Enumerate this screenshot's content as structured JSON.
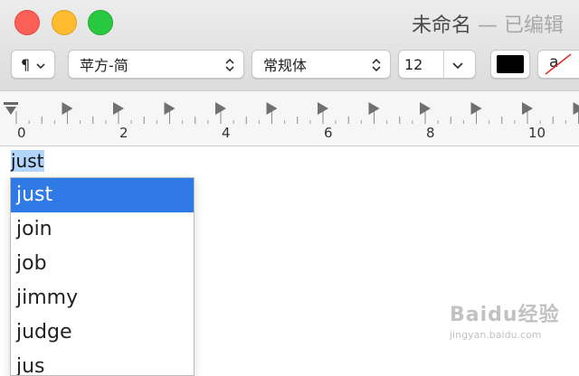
{
  "window": {
    "title": "未命名",
    "title_separator": "—",
    "status": "已编辑"
  },
  "toolbar": {
    "paragraph_style_icon": "¶",
    "font_family": "苹方-简",
    "font_style": "常规体",
    "font_size": "12",
    "text_color": "#000000",
    "highlight_glyph": "a"
  },
  "ruler": {
    "labels": [
      "0",
      "2",
      "4",
      "6",
      "8",
      "10"
    ]
  },
  "document": {
    "typed_text": "just"
  },
  "autocomplete": {
    "suggestions": [
      "just",
      "join",
      "job",
      "jimmy",
      "judge",
      "jus"
    ],
    "selected_index": 0
  },
  "watermark": {
    "brand": "Baidu经验",
    "site": "jingyan.baidu.com"
  },
  "colors": {
    "selection_blue": "#2f7ae5",
    "text_highlight": "#b3d5fb",
    "close": "#fe5f57",
    "minimize": "#febc2e",
    "zoom": "#28c840"
  }
}
